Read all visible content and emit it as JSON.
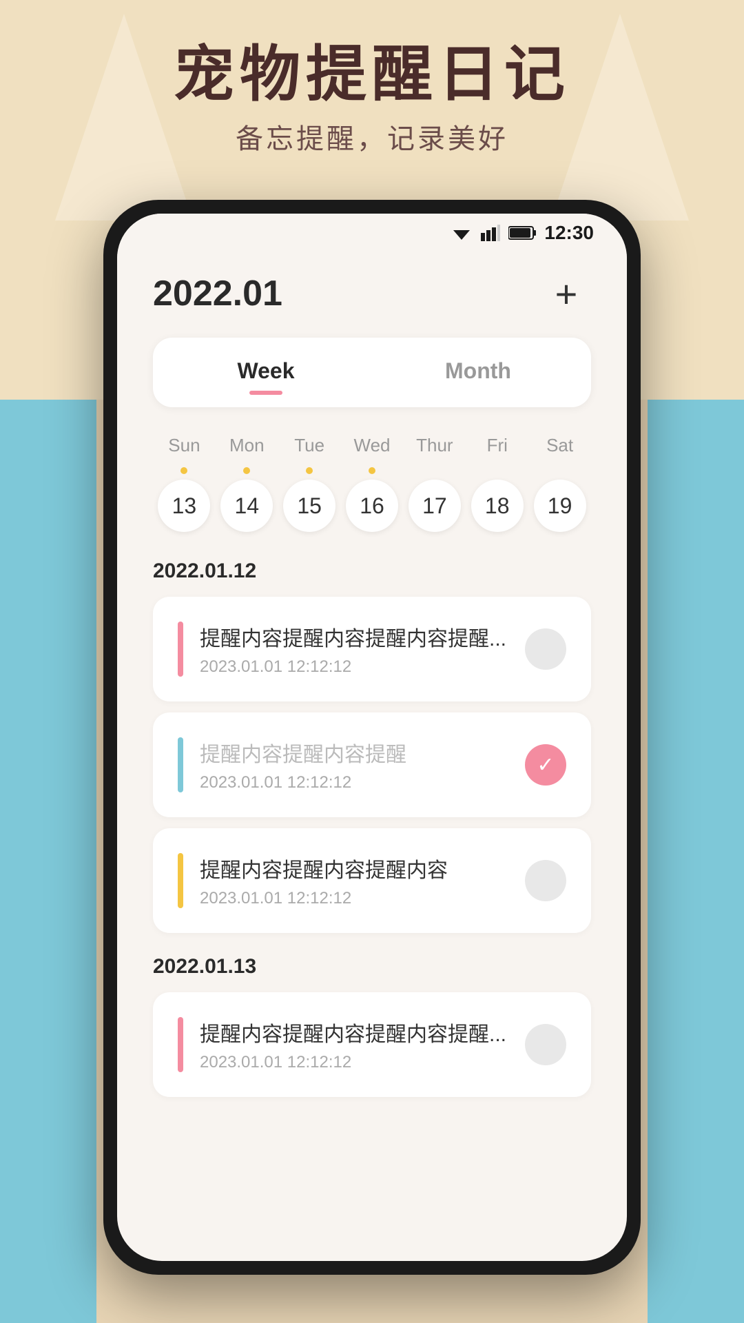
{
  "app": {
    "title_main": "宠物提醒日记",
    "title_sub": "备忘提醒，记录美好"
  },
  "status_bar": {
    "time": "12:30"
  },
  "header": {
    "year_month": "2022.01",
    "add_label": "+"
  },
  "tabs": [
    {
      "id": "week",
      "label": "Week",
      "active": true
    },
    {
      "id": "month",
      "label": "Month",
      "active": false
    }
  ],
  "week_days": [
    {
      "label": "Sun",
      "number": "13",
      "dot": true
    },
    {
      "label": "Mon",
      "number": "14",
      "dot": true
    },
    {
      "label": "Tue",
      "number": "15",
      "dot": true
    },
    {
      "label": "Wed",
      "number": "16",
      "dot": true
    },
    {
      "label": "Thur",
      "number": "17",
      "dot": false
    },
    {
      "label": "Fri",
      "number": "18",
      "dot": false
    },
    {
      "label": "Sat",
      "number": "19",
      "dot": false
    }
  ],
  "sections": [
    {
      "date": "2022.01.12",
      "reminders": [
        {
          "bar_color": "bar-pink",
          "title": "提醒内容提醒内容提醒内容提醒...",
          "time": "2023.01.01  12:12:12",
          "checked": false,
          "muted": false
        },
        {
          "bar_color": "bar-blue",
          "title": "提醒内容提醒内容提醒",
          "time": "2023.01.01  12:12:12",
          "checked": true,
          "muted": true
        },
        {
          "bar_color": "bar-yellow",
          "title": "提醒内容提醒内容提醒内容",
          "time": "2023.01.01  12:12:12",
          "checked": false,
          "muted": false
        }
      ]
    },
    {
      "date": "2022.01.13",
      "reminders": [
        {
          "bar_color": "bar-pink",
          "title": "提醒内容提醒内容提醒内容提醒...",
          "time": "2023.01.01  12:12:12",
          "checked": false,
          "muted": false
        }
      ]
    }
  ]
}
